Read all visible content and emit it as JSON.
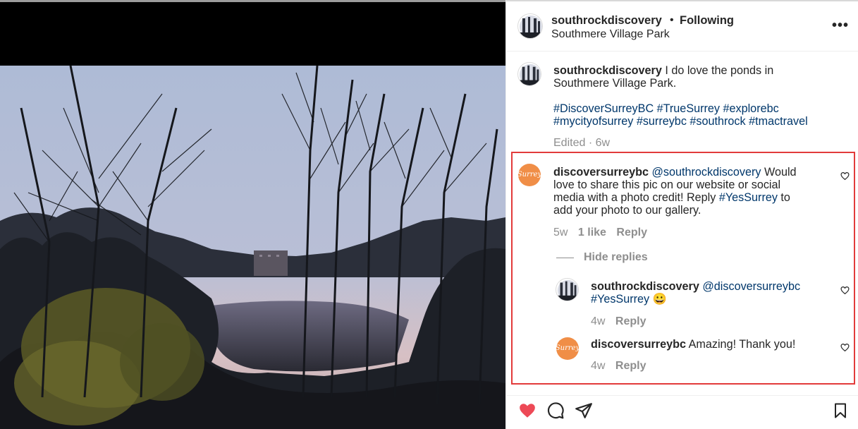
{
  "post": {
    "username": "southrockdiscovery",
    "separator": "•",
    "follow_status": "Following",
    "location": "Southmere Village Park",
    "more_label": "•••"
  },
  "caption": {
    "username": "southrockdiscovery",
    "line1": " I do love the ponds in",
    "line2": "Southmere Village Park.",
    "hashtags_line1": "#DiscoverSurreyBC #TrueSurrey #explorebc",
    "hashtags_line2": "#mycityofsurrey #surreybc #southrock #tmactravel",
    "meta": "Edited · 6w"
  },
  "comments": [
    {
      "username": "discoversurreybc",
      "avatar_text": "Surrey",
      "mention": "@southrockdiscovery",
      "text_line1_after": " Would",
      "text_line2": "love to share this pic on our website or social",
      "text_line3_before": "media with a photo credit! Reply ",
      "hashtag": "#YesSurrey",
      "text_line3_after": " to",
      "text_line4": "add your photo to our gallery.",
      "time": "5w",
      "likes": "1 like",
      "reply": "Reply",
      "hide_replies": "Hide replies"
    }
  ],
  "replies": [
    {
      "username": "southrockdiscovery",
      "mention": "@discoversurreybc",
      "hashtag": "#YesSurrey",
      "emoji": "😀",
      "time": "4w",
      "reply": "Reply"
    },
    {
      "username": "discoversurreybc",
      "avatar_text": "Surrey",
      "text": " Amazing! Thank you!",
      "time": "4w",
      "reply": "Reply"
    }
  ],
  "icons": {
    "like": "heart-filled-icon",
    "comment": "comment-icon",
    "share": "paper-plane-icon",
    "save": "bookmark-icon",
    "comment_like": "heart-outline-icon"
  },
  "colors": {
    "like_red": "#ed4956",
    "link_blue": "#00376b",
    "highlight_red": "#e23b3b",
    "avatar_orange": "#f08e47"
  }
}
